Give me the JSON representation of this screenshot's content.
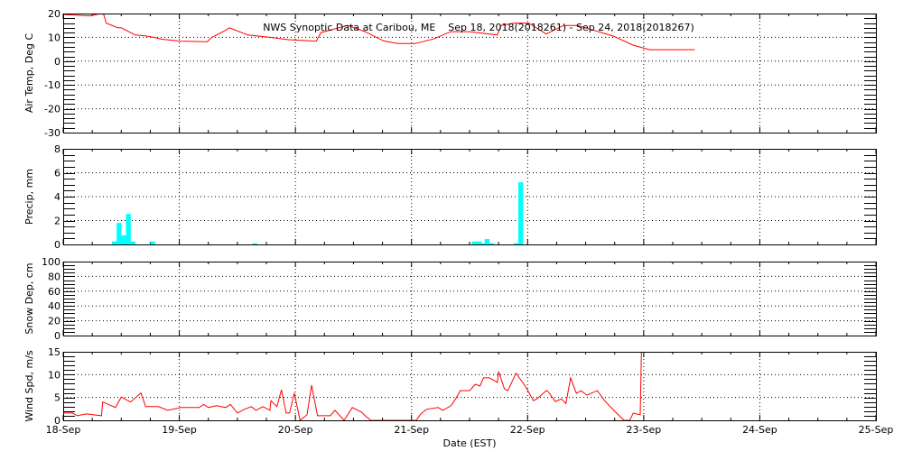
{
  "chart_data": [
    {
      "type": "line",
      "title": "NWS Synoptic Data at Caribou, ME    Sep 18, 2018(2018261) - Sep 24, 2018(2018267)",
      "ylabel": "Air Temp, Deg C",
      "ylim": [
        -30,
        20
      ],
      "yticks": [
        "20",
        "10",
        "0",
        "-10",
        "-20",
        "-30"
      ],
      "ytick_values": [
        20,
        10,
        0,
        -10,
        -20,
        -30
      ],
      "minor_step": 2,
      "grid": true,
      "color": "#ff0000",
      "x_days": [
        0.01,
        0.23,
        0.33,
        0.35,
        0.37,
        0.47,
        0.5,
        0.62,
        0.7,
        0.78,
        0.85,
        1.01,
        1.24,
        1.28,
        1.4,
        1.43,
        1.59,
        1.78,
        1.94,
        2.18,
        2.22,
        2.45,
        2.6,
        2.76,
        2.88,
        3.03,
        3.19,
        3.34,
        3.5,
        3.74,
        3.77,
        3.89,
        4.01,
        4.16,
        4.31,
        4.43,
        4.74,
        4.91,
        5.05,
        5.2,
        5.27,
        5.44
      ],
      "values": [
        19.5,
        19,
        20,
        19.5,
        16,
        14,
        14,
        11,
        10.7,
        10,
        9.2,
        8.4,
        8.2,
        10,
        13,
        14,
        11,
        10,
        9,
        8.4,
        12,
        15,
        12.4,
        8.5,
        7.4,
        7.4,
        9.3,
        12.4,
        12.4,
        11,
        15,
        16,
        16,
        11.4,
        15,
        15,
        10.5,
        6.7,
        4.8,
        4.8,
        4.8,
        4.8
      ]
    },
    {
      "type": "bar",
      "ylabel": "Precip, mm",
      "ylim": [
        0,
        8
      ],
      "yticks": [
        "8",
        "6",
        "4",
        "2",
        "0"
      ],
      "ytick_values": [
        8,
        6,
        4,
        2,
        0
      ],
      "minor_step": 0.5,
      "grid": true,
      "color": "#00ffff",
      "bar_width_days": 0.0417,
      "x_days": [
        0.42,
        0.46,
        0.5,
        0.54,
        0.58,
        0.75,
        1.63,
        3.52,
        3.56,
        3.6,
        3.63,
        3.67,
        3.88,
        3.92
      ],
      "values": [
        0.25,
        1.8,
        0.75,
        2.55,
        0.25,
        0.25,
        0.1,
        0.25,
        0.25,
        0.1,
        0.45,
        0.1,
        0.1,
        5.2
      ]
    },
    {
      "type": "line",
      "ylabel": "Snow Dep, cm",
      "ylim": [
        0,
        100
      ],
      "yticks": [
        "100",
        "80",
        "60",
        "40",
        "20",
        "0"
      ],
      "ytick_values": [
        100,
        80,
        60,
        40,
        20,
        0
      ],
      "minor_step": 5,
      "grid": true,
      "color": "#ff0000",
      "x_days": [],
      "values": []
    },
    {
      "type": "line",
      "ylabel": "Wind Spd, m/s",
      "ylim": [
        0,
        15
      ],
      "yticks": [
        "15",
        "10",
        "5",
        "0"
      ],
      "ytick_values": [
        15,
        10,
        5,
        0
      ],
      "minor_step": 1,
      "grid": true,
      "color": "#ff0000",
      "x_days": [
        0.0,
        0.08,
        0.12,
        0.2,
        0.33,
        0.34,
        0.45,
        0.5,
        0.58,
        0.67,
        0.71,
        0.82,
        0.9,
        0.98,
        1.01,
        1.17,
        1.21,
        1.25,
        1.32,
        1.4,
        1.44,
        1.5,
        1.56,
        1.62,
        1.66,
        1.72,
        1.78,
        1.79,
        1.84,
        1.88,
        1.92,
        1.95,
        1.99,
        2.04,
        2.1,
        2.14,
        2.19,
        2.3,
        2.34,
        2.42,
        2.49,
        2.57,
        2.6,
        2.65,
        2.69,
        2.72,
        2.81,
        3.04,
        3.08,
        3.13,
        3.13,
        3.23,
        3.27,
        3.34,
        3.38,
        3.42,
        3.5,
        3.55,
        3.59,
        3.62,
        3.67,
        3.74,
        3.75,
        3.8,
        3.83,
        3.9,
        3.98,
        4.05,
        4.08,
        4.16,
        4.17,
        4.24,
        4.29,
        4.33,
        4.37,
        4.42,
        4.46,
        4.51,
        4.6,
        4.67,
        4.75,
        4.83,
        4.88,
        4.91,
        4.97,
        4.98,
        5.0
      ],
      "values": [
        1.6,
        1.6,
        1,
        1.4,
        1,
        4,
        2.8,
        5.1,
        4,
        6,
        3,
        3,
        2.2,
        2.6,
        2.8,
        2.8,
        3.5,
        2.8,
        3.2,
        2.8,
        3.5,
        1.6,
        2.4,
        3,
        2.2,
        3,
        2.2,
        4.3,
        3,
        6.7,
        1.6,
        1.6,
        6,
        0,
        1.2,
        7.7,
        1,
        1,
        2.2,
        0,
        2.8,
        1.8,
        1,
        0,
        0,
        0,
        0,
        0,
        1.4,
        2.4,
        2.4,
        2.8,
        2.2,
        3.2,
        4.7,
        6.5,
        6.5,
        7.9,
        7.5,
        9.3,
        9.3,
        8.3,
        10.7,
        6.9,
        6.5,
        10.3,
        7.5,
        4.3,
        4.7,
        6.5,
        6.5,
        4.1,
        4.7,
        3.7,
        9.3,
        5.9,
        6.5,
        5.5,
        6.5,
        4.1,
        2,
        0,
        0,
        1.6,
        1.2,
        15,
        17
      ]
    }
  ],
  "x_axis": {
    "xlabel": "Date (EST)",
    "ticks": [
      "18-Sep",
      "19-Sep",
      "20-Sep",
      "21-Sep",
      "22-Sep",
      "23-Sep",
      "24-Sep",
      "25-Sep"
    ],
    "xlim_days": [
      0,
      7
    ]
  }
}
